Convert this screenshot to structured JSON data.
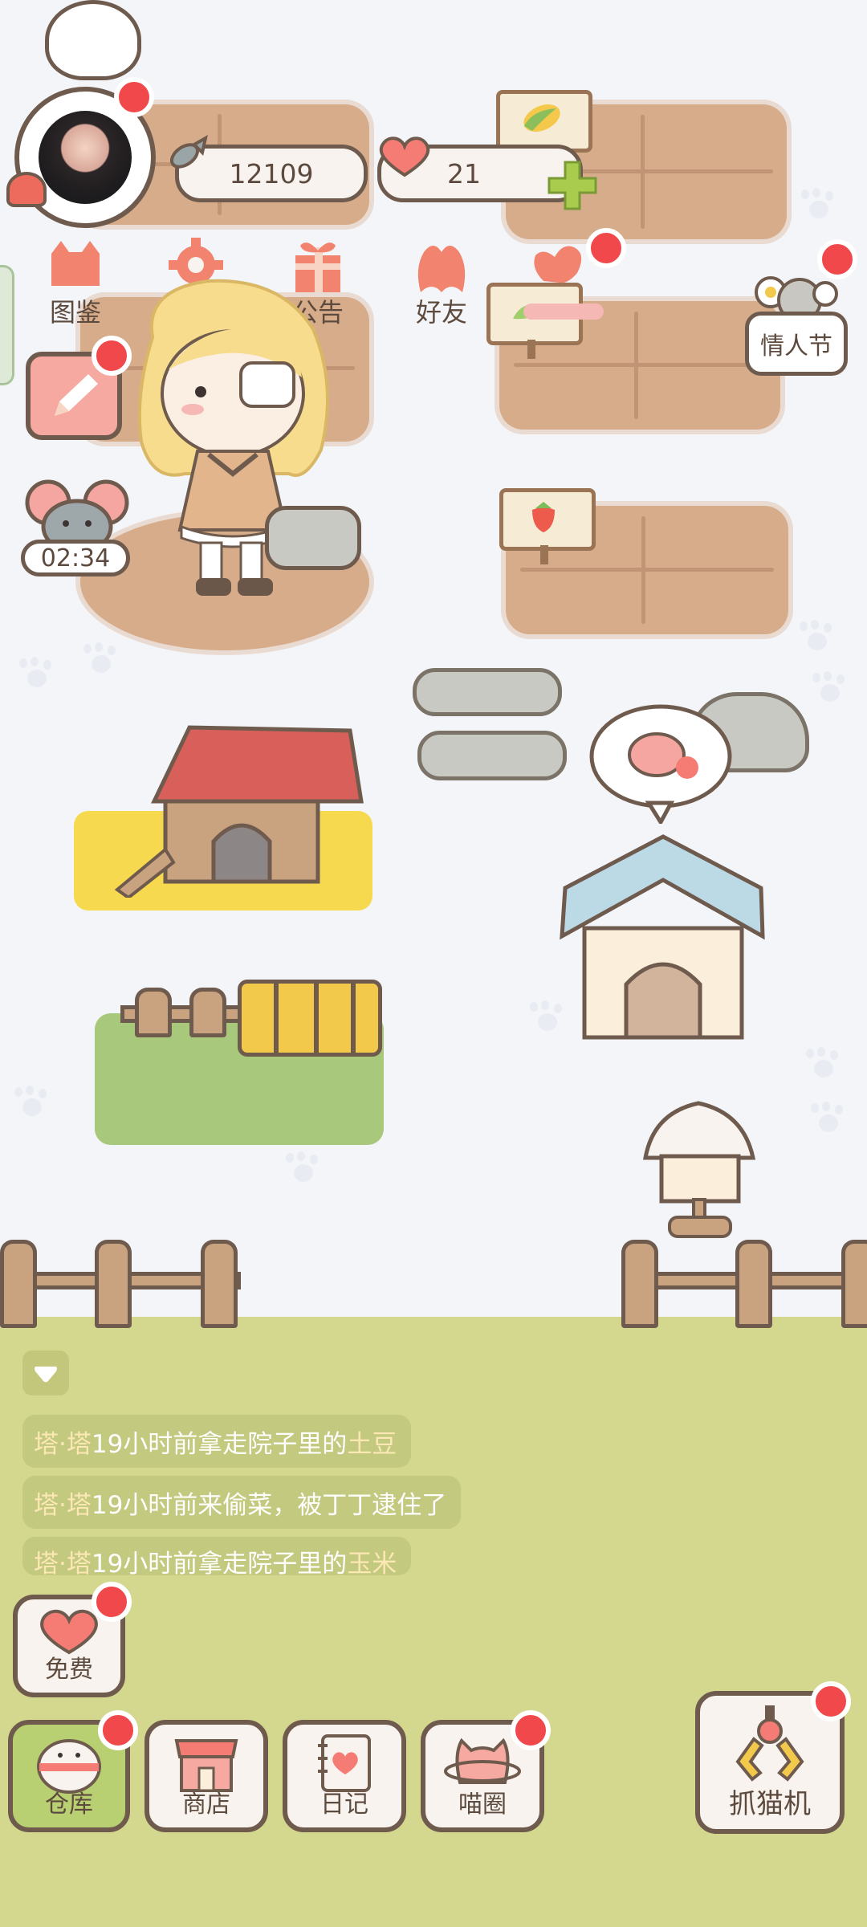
{
  "hud": {
    "coins": "12109",
    "hearts": "21",
    "coin_icon": "fish-icon",
    "heart_icon": "heart-icon",
    "add_icon": "plus-icon"
  },
  "menu": {
    "items": [
      {
        "label": "图鉴",
        "icon": "cat-book-icon"
      },
      {
        "label": "设置",
        "icon": "gear-icon"
      },
      {
        "label": "公告",
        "icon": "gift-icon"
      },
      {
        "label": "好友",
        "icon": "friends-icon"
      },
      {
        "label": "",
        "icon": "heart-hands-icon"
      }
    ]
  },
  "side": {
    "event_label": "情人节",
    "timer": "02:34"
  },
  "log": {
    "messages": [
      {
        "name": "塔·塔",
        "text": "19小时前拿走院子里的",
        "item": "土豆"
      },
      {
        "name": "塔·塔",
        "text": "19小时前来偷菜，被丁丁逮住了",
        "item": ""
      },
      {
        "name": "塔·塔",
        "text": "19小时前拿走院子里的",
        "item": "玉米"
      }
    ]
  },
  "bottom": {
    "free_label": "免费",
    "warehouse_label": "仓库",
    "shop_label": "商店",
    "diary_label": "日记",
    "circle_label": "喵圈",
    "claw_label": "抓猫机"
  },
  "colors": {
    "accent_red": "#f1484c",
    "outline_brown": "#6f5b4e",
    "grass": "#d4d88e",
    "soil": "#d6ac8a"
  }
}
